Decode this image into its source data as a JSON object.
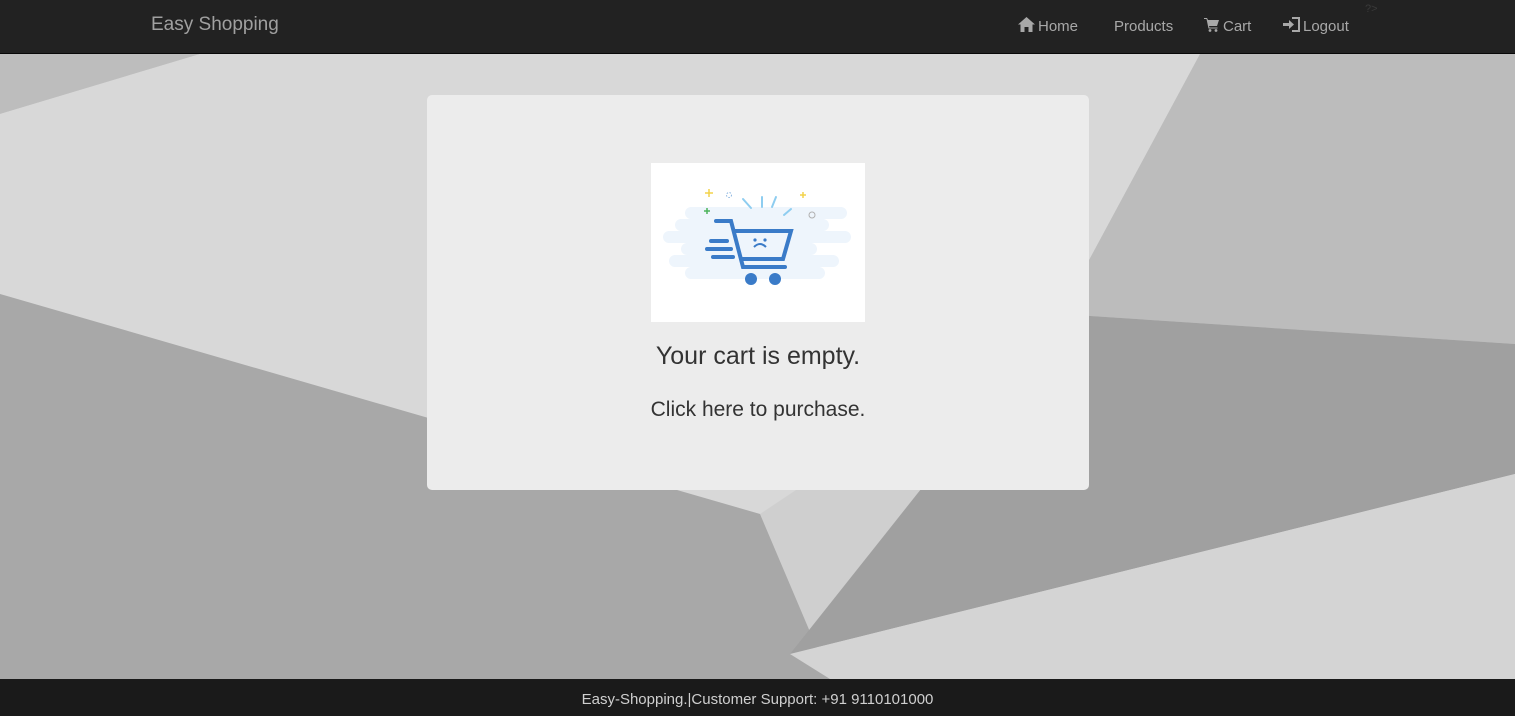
{
  "navbar": {
    "brand": "Easy Shopping",
    "items": [
      {
        "label": "Home",
        "icon": "home-icon"
      },
      {
        "label": "Products",
        "icon": ""
      },
      {
        "label": "Cart",
        "icon": "cart-icon"
      },
      {
        "label": "Logout",
        "icon": "logout-icon"
      }
    ],
    "stray_text": "?>"
  },
  "cart": {
    "empty_title": "Your cart is empty.",
    "purchase_link": "Click here to purchase."
  },
  "footer": {
    "text": "Easy-Shopping.|Customer Support: +91 9110101000"
  },
  "colors": {
    "navbar_bg": "#222222",
    "footer_bg": "#1a1a1a",
    "cart_blue": "#3a7bc8"
  }
}
